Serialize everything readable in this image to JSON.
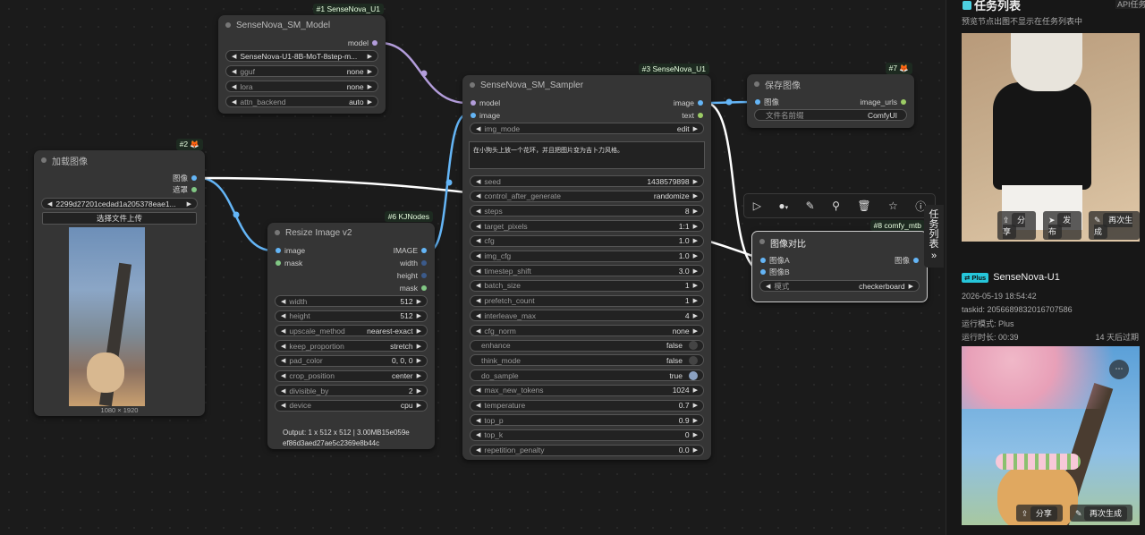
{
  "nodes": {
    "model": {
      "badge": "#1 SenseNova_U1",
      "title": "SenseNova_SM_Model",
      "out": "model",
      "widgets": [
        {
          "label": "",
          "value": "SenseNova-U1-8B-MoT-8step-m..."
        },
        {
          "label": "gguf",
          "value": "none"
        },
        {
          "label": "lora",
          "value": "none"
        },
        {
          "label": "attn_backend",
          "value": "auto"
        }
      ]
    },
    "load": {
      "badge": "#2 🦊",
      "title": "加载图像",
      "outs": [
        "图像",
        "遮罩"
      ],
      "file": "2299d27201cedad1a205378eae1...",
      "upload": "选择文件上传",
      "dims": "1080 × 1920"
    },
    "resize": {
      "badge": "#6 KJNodes",
      "title": "Resize Image v2",
      "ins": [
        "image",
        "mask"
      ],
      "outs": [
        "IMAGE",
        "width",
        "height",
        "mask"
      ],
      "widgets": [
        {
          "label": "width",
          "value": "512"
        },
        {
          "label": "height",
          "value": "512"
        },
        {
          "label": "upscale_method",
          "value": "nearest-exact"
        },
        {
          "label": "keep_proportion",
          "value": "stretch"
        },
        {
          "label": "pad_color",
          "value": "0, 0, 0"
        },
        {
          "label": "crop_position",
          "value": "center"
        },
        {
          "label": "divisible_by",
          "value": "2"
        },
        {
          "label": "device",
          "value": "cpu"
        }
      ],
      "output_line1": "Output: 1 x 512 x 512 | 3.00MB15e059e",
      "output_line2": "ef86d3aed27ae5c2369e8b44c"
    },
    "sampler": {
      "badge": "#3 SenseNova_U1",
      "title": "SenseNova_SM_Sampler",
      "ins": [
        "model",
        "image"
      ],
      "outs": [
        "image",
        "text"
      ],
      "img_mode": {
        "label": "img_mode",
        "value": "edit"
      },
      "prompt": "在小狗头上放一个花环，并且把图片变为吉卜力风格。",
      "widgets": [
        {
          "label": "seed",
          "value": "1438579898"
        },
        {
          "label": "control_after_generate",
          "value": "randomize"
        },
        {
          "label": "steps",
          "value": "8"
        },
        {
          "label": "target_pixels",
          "value": "1:1"
        },
        {
          "label": "cfg",
          "value": "1.0"
        },
        {
          "label": "img_cfg",
          "value": "1.0"
        },
        {
          "label": "timestep_shift",
          "value": "3.0"
        },
        {
          "label": "batch_size",
          "value": "1"
        },
        {
          "label": "prefetch_count",
          "value": "1"
        },
        {
          "label": "interleave_max",
          "value": "4"
        },
        {
          "label": "cfg_norm",
          "value": "none"
        },
        {
          "label": "enhance",
          "value": "false",
          "toggle": true
        },
        {
          "label": "think_mode",
          "value": "false",
          "toggle": true
        },
        {
          "label": "do_sample",
          "value": "true",
          "toggle": true
        },
        {
          "label": "max_new_tokens",
          "value": "1024"
        },
        {
          "label": "temperature",
          "value": "0.7"
        },
        {
          "label": "top_p",
          "value": "0.9"
        },
        {
          "label": "top_k",
          "value": "0"
        },
        {
          "label": "repetition_penalty",
          "value": "0.0"
        }
      ]
    },
    "save": {
      "badge": "#7 🦊",
      "title": "保存图像",
      "in": "图像",
      "out": "image_urls",
      "widget": {
        "label": "文件名前缀",
        "value": "ComfyUI"
      }
    },
    "compare": {
      "badge": "#8 comfy_mtb",
      "title": "图像对比",
      "ins": [
        "图像A",
        "图像B"
      ],
      "out": "图像",
      "widget": {
        "label": "模式",
        "value": "checkerboard"
      }
    }
  },
  "side_tab": "任务列表",
  "sidebar": {
    "title": "任务列表",
    "api_tab": "API任务",
    "hint": "预览节点出图不显示在任务列表中",
    "actions1": [
      "分享",
      "发布",
      "再次生成"
    ],
    "plus_badge": "Plus",
    "task_name": "SenseNova-U1",
    "date": "2026-05-19 18:54:42",
    "taskid": "taskid: 2056689832016707586",
    "mode": "运行模式: Plus",
    "duration": "运行时长: 00:39",
    "expire": "14 天后过期",
    "actions2": [
      "分享",
      "再次生成"
    ]
  },
  "colors": {
    "model_wire": "#b39ddb",
    "image_wire": "#64b5f6",
    "link_white": "#ffffff"
  }
}
